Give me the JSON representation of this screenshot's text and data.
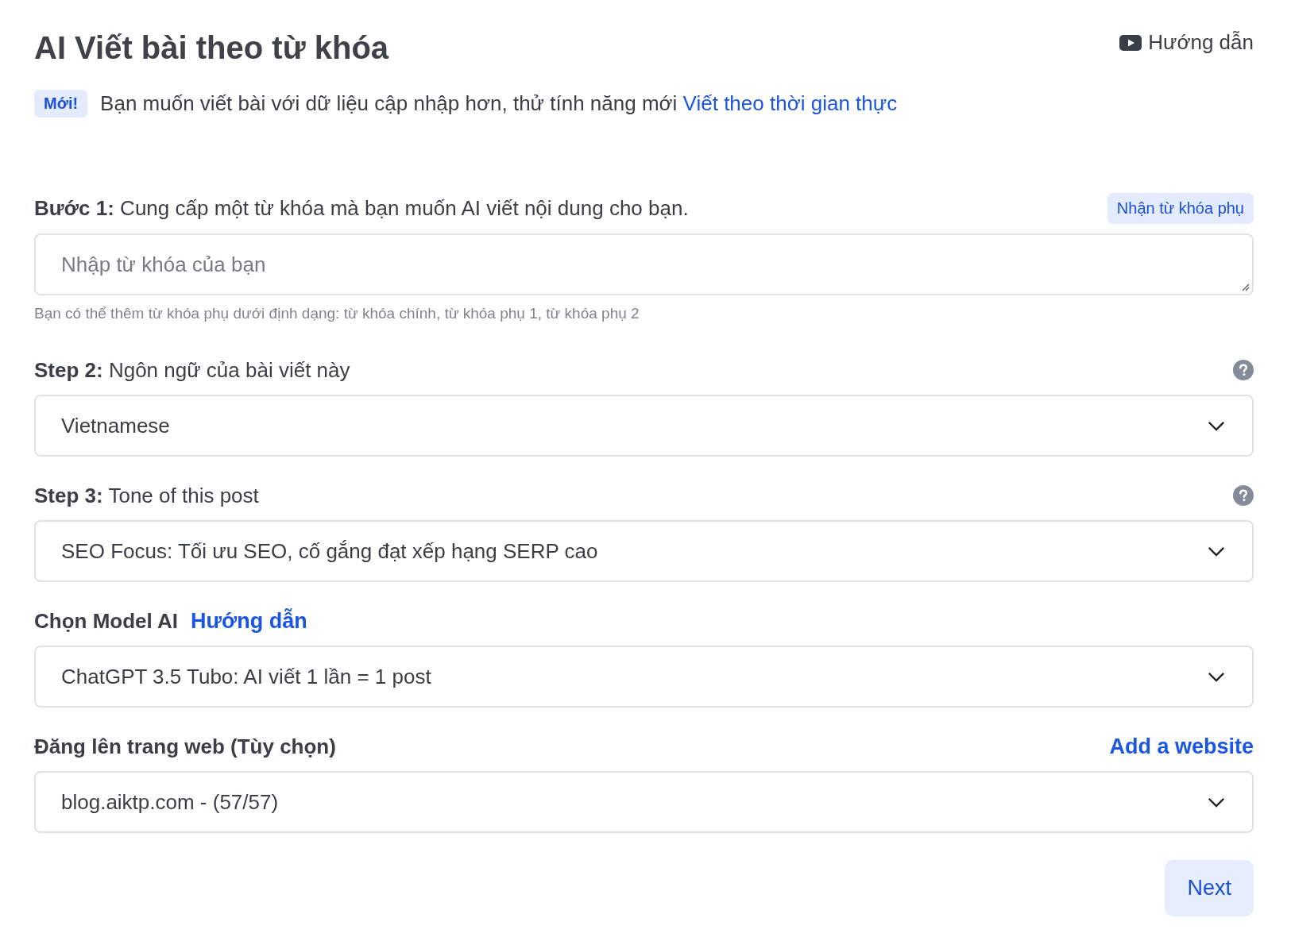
{
  "header": {
    "title": "AI Viết bài theo từ khóa",
    "guide_link": "Hướng dẫn"
  },
  "notice": {
    "badge": "Mới!",
    "text": "Bạn muốn viết bài với dữ liệu cập nhập hơn, thử tính năng mới",
    "link": "Viết theo thời gian thực"
  },
  "steps": [
    {
      "label_prefix": "Bước 1:",
      "label": "Cung cấp một từ khóa mà bạn muốn AI viết nội dung cho bạn.",
      "help": false,
      "action": {
        "kind": "chip",
        "text": "Nhận từ khóa phụ"
      },
      "field": {
        "kind": "textarea",
        "placeholder": "Nhập từ khóa của bạn"
      },
      "hint": "Bạn có thể thêm từ khóa phụ dưới định dạng: từ khóa chính, từ khóa phụ 1, từ khóa phụ 2"
    },
    {
      "label_prefix": "Step 2:",
      "label": "Ngôn ngữ của bài viết này",
      "help": true,
      "field": {
        "kind": "select",
        "value": "Vietnamese"
      }
    },
    {
      "label_prefix": "Step 3:",
      "label": "Tone of this post",
      "help": true,
      "field": {
        "kind": "select",
        "value": "SEO Focus: Tối ưu SEO, cố gắng đạt xếp hạng SERP cao"
      }
    },
    {
      "label_prefix": "Chọn Model AI",
      "inline_link": "Hướng dẫn",
      "help": false,
      "field": {
        "kind": "select",
        "value": "ChatGPT 3.5 Tubo: AI viết 1 lần = 1 post"
      }
    },
    {
      "label_prefix": "Đăng lên trang web (Tùy chọn)",
      "help": false,
      "action": {
        "kind": "link",
        "text": "Add a website"
      },
      "field": {
        "kind": "select",
        "value": "blog.aiktp.com - (57/57)"
      }
    }
  ],
  "next_button": "Next"
}
